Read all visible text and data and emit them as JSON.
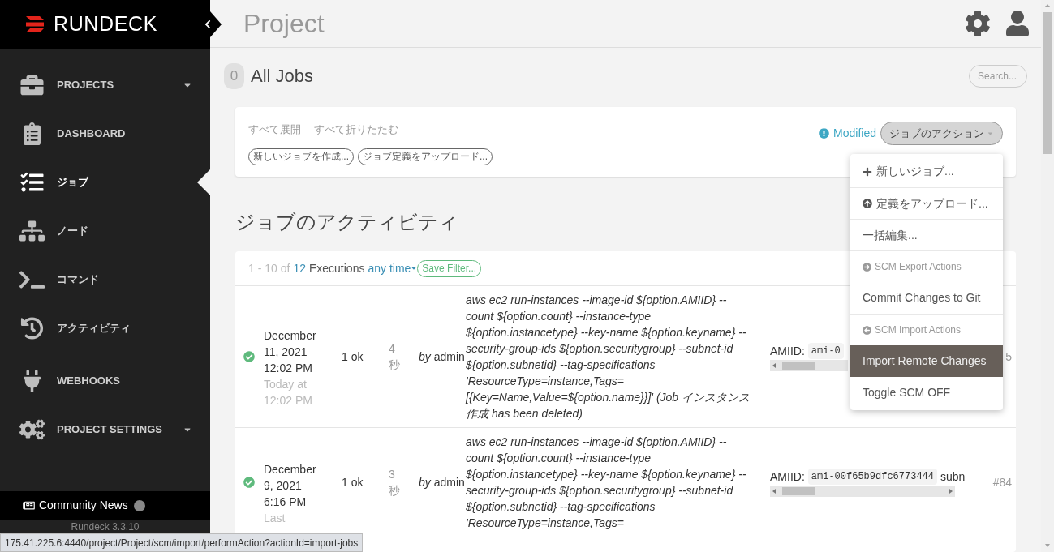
{
  "brand": {
    "name": "RUNDECK"
  },
  "sidebar": {
    "sections": [
      {
        "items": [
          {
            "label": "PROJECTS",
            "caret": true,
            "selected": false
          },
          {
            "label": "DASHBOARD",
            "caret": false,
            "selected": false
          },
          {
            "label": "ジョブ",
            "caret": false,
            "selected": true
          },
          {
            "label": "ノード",
            "caret": false,
            "selected": false
          },
          {
            "label": "コマンド",
            "caret": false,
            "selected": false
          },
          {
            "label": "アクティビティ",
            "caret": false,
            "selected": false
          }
        ]
      },
      {
        "items": [
          {
            "label": "WEBHOOKS",
            "caret": false,
            "selected": false
          },
          {
            "label": "PROJECT SETTINGS",
            "caret": true,
            "selected": false
          }
        ]
      }
    ],
    "news": {
      "label": "Community News"
    },
    "version": "Rundeck 3.3.10"
  },
  "header": {
    "title": "Project"
  },
  "jobs": {
    "count": "0",
    "title": "All Jobs",
    "search": {
      "placeholder": "Search..."
    },
    "links": [
      "すべて展開",
      "すべて折りたたむ"
    ],
    "buttons": [
      "新しいジョブを作成...",
      "ジョブ定義をアップロード..."
    ],
    "modified": "Modified",
    "actions_button": "ジョブのアクション",
    "menu": [
      {
        "kind": "add",
        "label": "新しいジョブ...",
        "highlighted": false
      },
      {
        "kind": "upload",
        "label": "定義をアップロード...",
        "highlighted": false
      },
      {
        "kind": "plain",
        "label": "一括編集...",
        "highlighted": false
      },
      {
        "kind": "export",
        "label": "SCM Export Actions"
      },
      {
        "kind": "plain",
        "label": "Commit Changes to Git",
        "highlighted": false
      },
      {
        "kind": "import",
        "label": "SCM Import Actions"
      },
      {
        "kind": "plain",
        "label": "Import Remote Changes",
        "highlighted": true
      },
      {
        "kind": "plain",
        "label": "Toggle SCM OFF",
        "highlighted": false
      }
    ]
  },
  "activity": {
    "title": "ジョブのアクティビティ",
    "summary": {
      "range": "1 - 10 of",
      "total": "12",
      "unit": "Executions",
      "time_filter": "any time",
      "save_filter": "Save Filter..."
    },
    "rows": [
      {
        "date": "December 11, 2021 12:02 PM",
        "relative": "Today at 12:02 PM",
        "result": "1 ok",
        "duration": "4 秒",
        "by": "by",
        "user": "admin",
        "command": "aws ec2 run-instances --image-id ${option.AMIID} --count ${option.count} --instance-type ${option.instancetype} --key-name ${option.keyname} --security-group-ids ${option.securitygroup} --subnet-id ${option.subnetid} --tag-specifications 'ResourceType=instance,Tags=[{Key=Name,Value=${option.name}}]' (Job インスタンス作成 has been deleted)",
        "arg_label": "AMIID:",
        "arg_value": "ami-0",
        "number": "5"
      },
      {
        "date": "December 9, 2021 6:16 PM",
        "relative": "Last",
        "result": "1 ok",
        "duration": "3 秒",
        "by": "by",
        "user": "admin",
        "command": "aws ec2 run-instances --image-id ${option.AMIID} --count ${option.count} --instance-type ${option.instancetype} --key-name ${option.keyname} --security-group-ids ${option.securitygroup} --subnet-id ${option.subnetid} --tag-specifications 'ResourceType=instance,Tags=",
        "arg_label": "AMIID:",
        "arg_value": "ami-00f65b9dfc6773444",
        "arg_more": "subn",
        "number": "#84"
      }
    ]
  },
  "status_bar": {
    "url": "175.41.225.6:4440/project/Project/scm/import/performAction?actionId=import-jobs"
  }
}
